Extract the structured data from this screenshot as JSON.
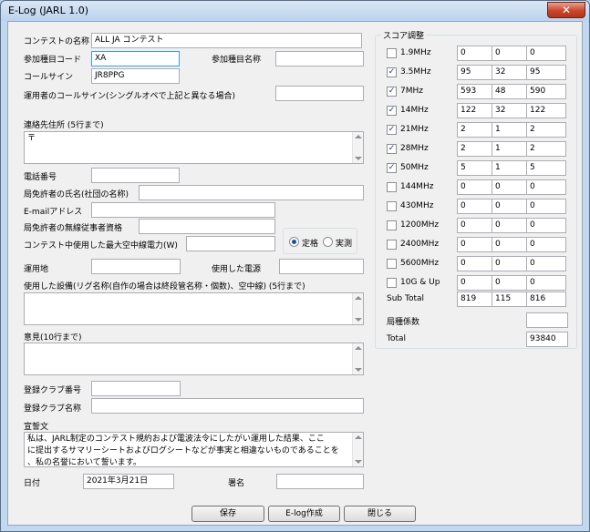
{
  "window": {
    "title": "E-Log (JARL 1.0)",
    "close_glyph": "✕"
  },
  "form": {
    "contest_name": {
      "label": "コンテストの名称",
      "value": "ALL JA コンテスト"
    },
    "category_code": {
      "label": "参加種目コード",
      "value": "XA"
    },
    "category_name": {
      "label": "参加種目名称",
      "value": ""
    },
    "callsign": {
      "label": "コールサイン",
      "value": "JR8PPG"
    },
    "operator_callsign": {
      "label": "運用者のコールサイン(シングルオペで上記と異なる場合)",
      "value": ""
    },
    "address": {
      "label": "連絡先住所 (5行まで)",
      "value": "〒"
    },
    "phone": {
      "label": "電話番号",
      "value": ""
    },
    "licensee_name": {
      "label": "局免許者の氏名(社団の名称)",
      "value": ""
    },
    "email": {
      "label": "E-mailアドレス",
      "value": ""
    },
    "licensee_qualification": {
      "label": "局免許者の無線従事者資格",
      "value": ""
    },
    "max_power": {
      "label": "コンテスト中使用した最大空中線電力(W)",
      "value": ""
    },
    "power_type": {
      "option1": "定格",
      "option2": "実測",
      "selected": "定格"
    },
    "location": {
      "label": "運用地",
      "value": ""
    },
    "power_source": {
      "label": "使用した電源",
      "value": ""
    },
    "equipment": {
      "label": "使用した設備(リグ名称(自作の場合は終段管名称・個数)、空中線) (5行まで)",
      "value": ""
    },
    "opinion": {
      "label": "意見(10行まで)",
      "value": ""
    },
    "club_number": {
      "label": "登録クラブ番号",
      "value": ""
    },
    "club_name": {
      "label": "登録クラブ名称",
      "value": ""
    },
    "oath": {
      "label": "宣誓文",
      "line1": "私は、JARL制定のコンテスト規約および電波法令にしたがい運用した結果、ここ",
      "line2": "に提出するサマリーシートおよびログシートなどが事実と相違ないものであることを",
      "line3": "、私の名誉において誓います。"
    },
    "date": {
      "label": "日付",
      "value": "2021年3月21日"
    },
    "signature": {
      "label": "署名",
      "value": ""
    }
  },
  "score": {
    "title": "スコア調整",
    "bands": [
      {
        "name": "1.9MHz",
        "checked": false,
        "a": "0",
        "b": "0",
        "c": "0"
      },
      {
        "name": "3.5MHz",
        "checked": true,
        "a": "95",
        "b": "32",
        "c": "95"
      },
      {
        "name": "7MHz",
        "checked": true,
        "a": "593",
        "b": "48",
        "c": "590"
      },
      {
        "name": "14MHz",
        "checked": true,
        "a": "122",
        "b": "32",
        "c": "122"
      },
      {
        "name": "21MHz",
        "checked": true,
        "a": "2",
        "b": "1",
        "c": "2"
      },
      {
        "name": "28MHz",
        "checked": true,
        "a": "2",
        "b": "1",
        "c": "2"
      },
      {
        "name": "50MHz",
        "checked": true,
        "a": "5",
        "b": "1",
        "c": "5"
      },
      {
        "name": "144MHz",
        "checked": false,
        "a": "0",
        "b": "0",
        "c": "0"
      },
      {
        "name": "430MHz",
        "checked": false,
        "a": "0",
        "b": "0",
        "c": "0"
      },
      {
        "name": "1200MHz",
        "checked": false,
        "a": "0",
        "b": "0",
        "c": "0"
      },
      {
        "name": "2400MHz",
        "checked": false,
        "a": "0",
        "b": "0",
        "c": "0"
      },
      {
        "name": "5600MHz",
        "checked": false,
        "a": "0",
        "b": "0",
        "c": "0"
      },
      {
        "name": "10G & Up",
        "checked": false,
        "a": "0",
        "b": "0",
        "c": "0"
      }
    ],
    "subtotal": {
      "label": "Sub Total",
      "a": "819",
      "b": "115",
      "c": "816"
    },
    "band_factor": {
      "label": "局種係数",
      "value": ""
    },
    "total": {
      "label": "Total",
      "value": "93840"
    }
  },
  "buttons": {
    "save": "保存",
    "create": "E-log作成",
    "close": "閉じる"
  },
  "colors": {
    "accent": "#3399ff",
    "check": "#1e3f6a",
    "close": "#c9462b"
  }
}
